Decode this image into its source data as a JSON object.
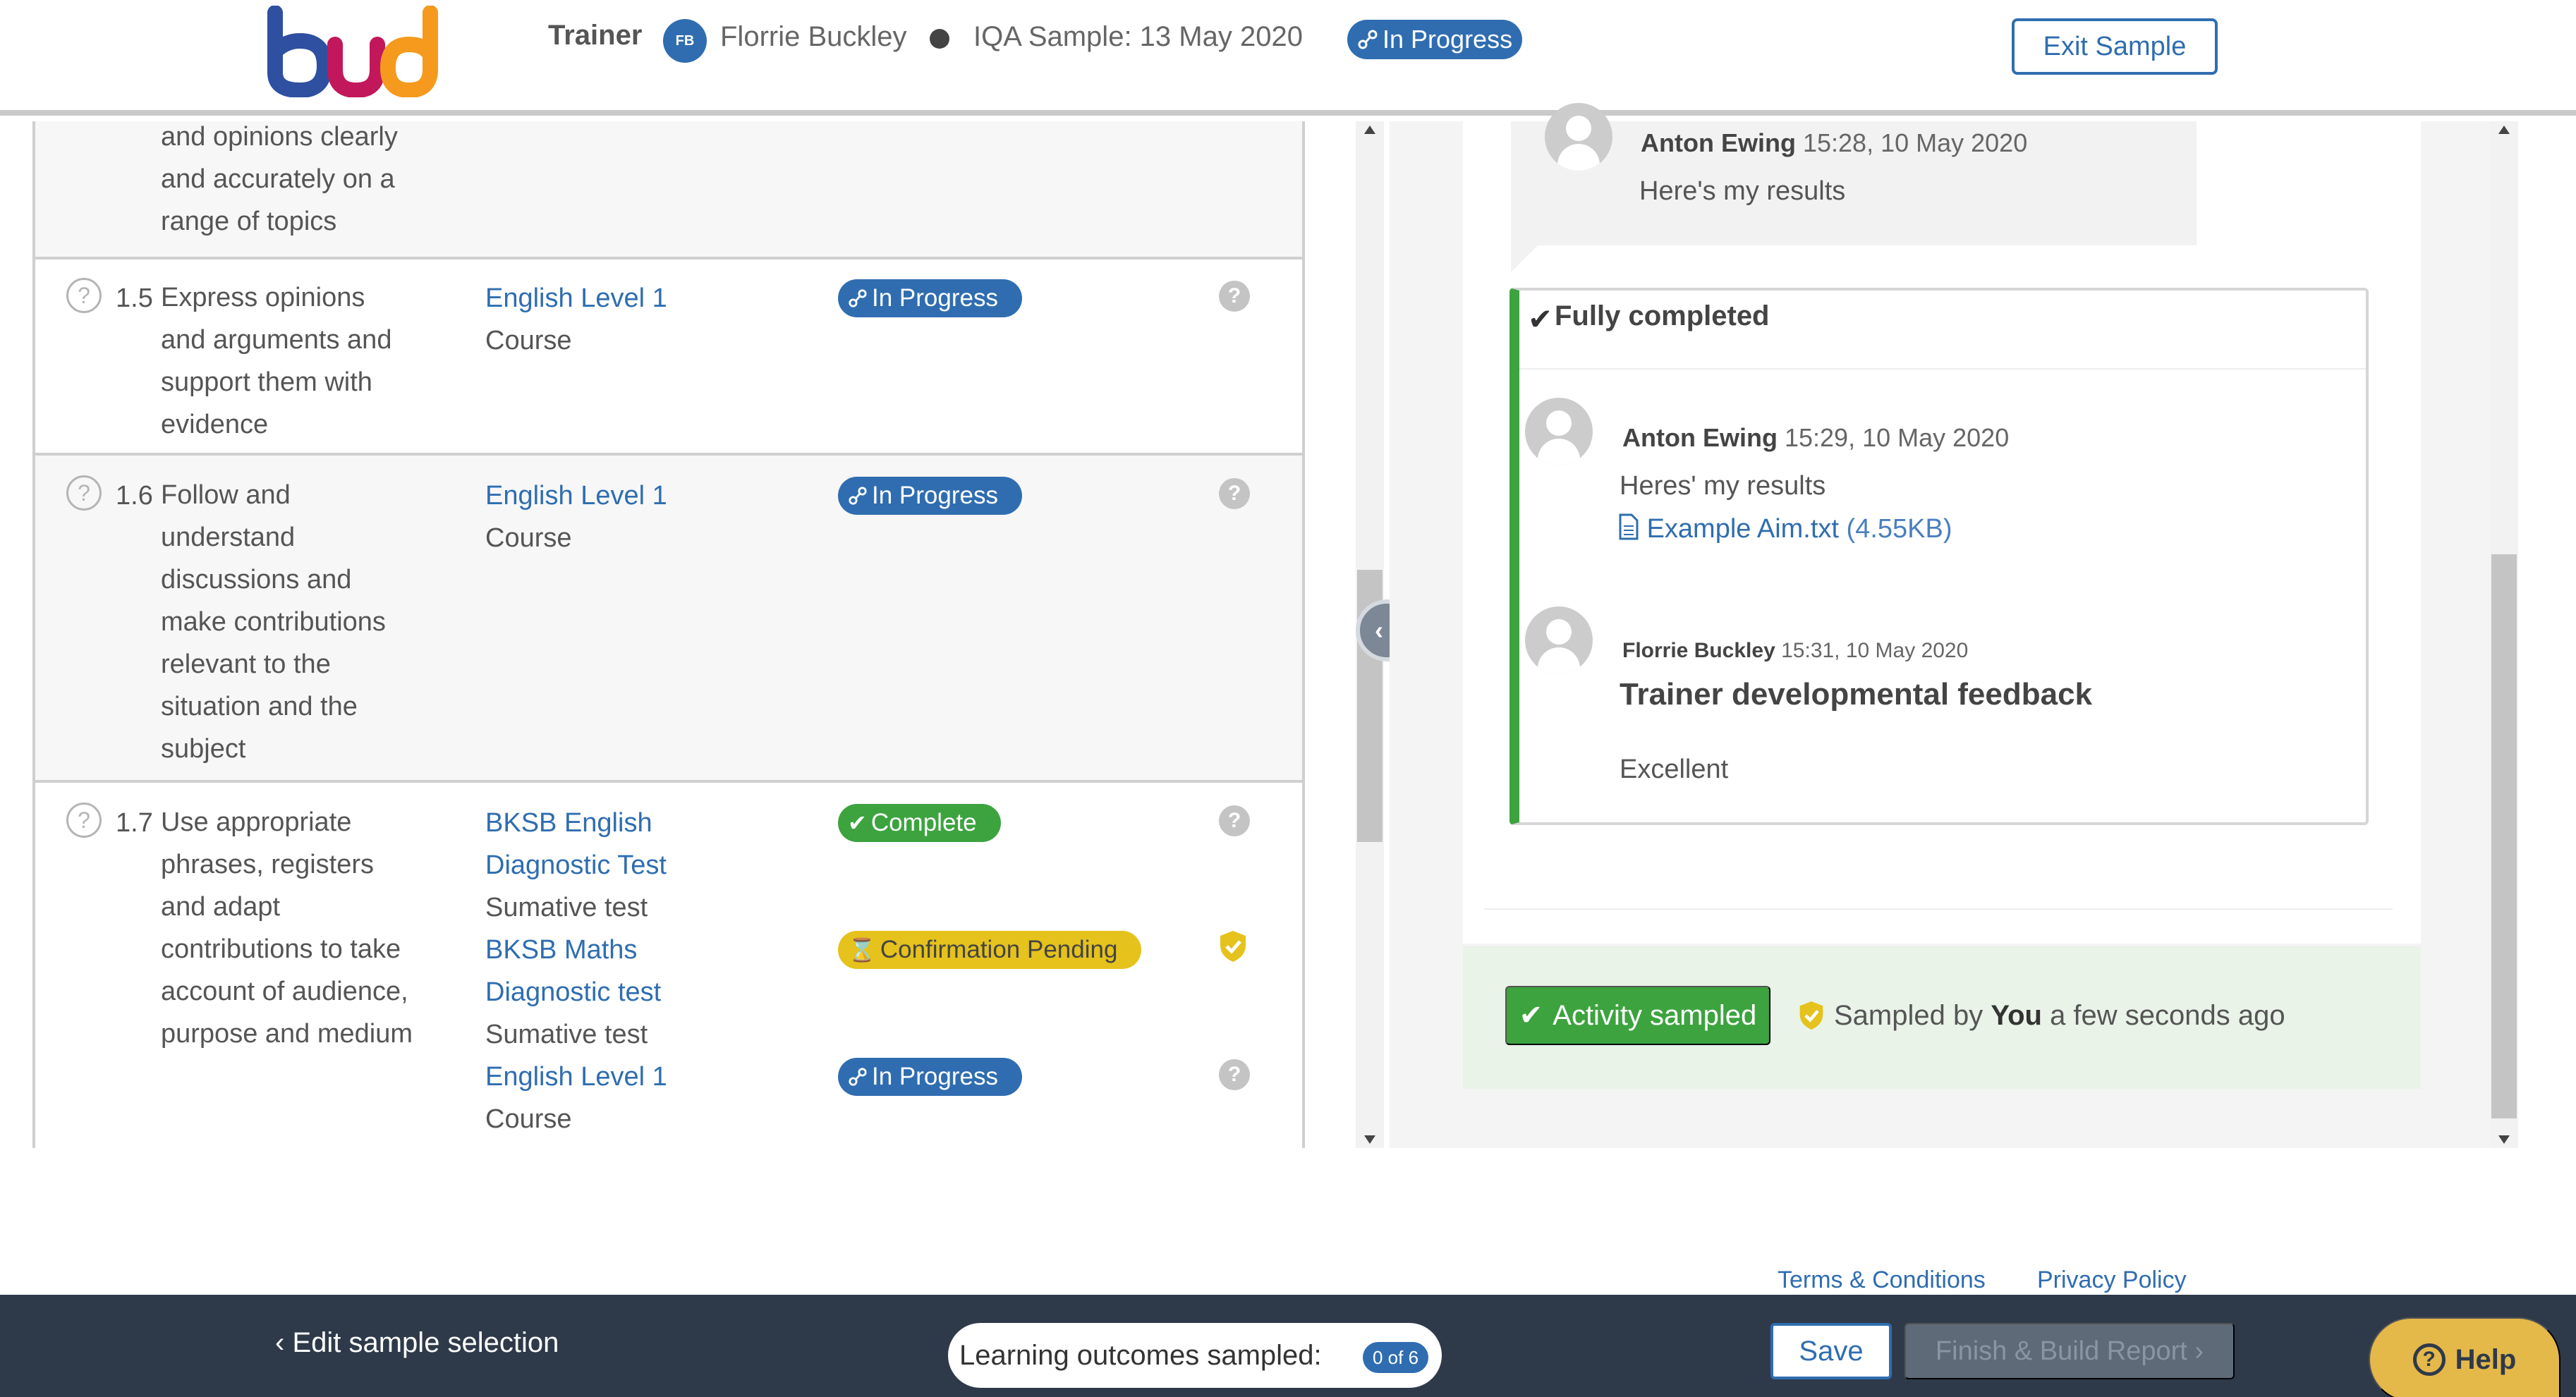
{
  "header": {
    "role": "Trainer",
    "avatar_initials": "FB",
    "user_name": "Florrie Buckley",
    "sample_label": "IQA Sample: 13 May 2020",
    "status": "In Progress",
    "exit_label": "Exit Sample"
  },
  "outcomes": {
    "partial_desc": [
      "and opinions clearly",
      "and accurately on a",
      "range of topics"
    ],
    "rows": [
      {
        "num": "1.5",
        "desc": [
          "Express opinions",
          "and arguments and",
          "support them with",
          "evidence"
        ],
        "activities": [
          {
            "title": "English Level 1",
            "type": "Course",
            "status": "In Progress"
          }
        ]
      },
      {
        "num": "1.6",
        "desc": [
          "Follow and",
          "understand",
          "discussions and",
          "make contributions",
          "relevant to the",
          "situation and the",
          "subject"
        ],
        "activities": [
          {
            "title": "English Level 1",
            "type": "Course",
            "status": "In Progress"
          }
        ]
      },
      {
        "num": "1.7",
        "desc": [
          "Use appropriate",
          "phrases, registers",
          "and adapt",
          "contributions to take",
          "account of audience,",
          "purpose and medium"
        ],
        "activities": [
          {
            "title_lines": [
              "BKSB English",
              "Diagnostic Test"
            ],
            "type": "Sumative test",
            "status": "Complete"
          },
          {
            "title_lines": [
              "BKSB Maths",
              "Diagnostic test"
            ],
            "type": "Sumative test",
            "status": "Confirmation Pending"
          },
          {
            "title": "English Level 1",
            "type": "Course",
            "status": "In Progress"
          }
        ]
      }
    ]
  },
  "activity_panel": {
    "first_message": {
      "author": "Anton Ewing",
      "time": "15:28, 10 May 2020",
      "text": "Here's my results"
    },
    "completed_title": "Fully completed",
    "second_message": {
      "author": "Anton Ewing",
      "time": "15:29, 10 May 2020",
      "text": "Heres' my results",
      "file_name": "Example Aim.txt",
      "file_size": "(4.55KB)"
    },
    "feedback": {
      "author": "Florrie Buckley",
      "time": "15:31, 10 May 2020",
      "title": "Trainer developmental feedback",
      "text": "Excellent"
    },
    "sampled_button": "Activity sampled",
    "sampled_by_prefix": "Sampled by",
    "sampled_by_user": "You",
    "sampled_by_suffix": "a few seconds ago"
  },
  "footer": {
    "terms": "Terms & Conditions",
    "privacy": "Privacy Policy"
  },
  "bottom_bar": {
    "edit_selection": "Edit sample selection",
    "outcomes_label": "Learning outcomes sampled:",
    "outcomes_count": "0 of 6",
    "save": "Save",
    "finish": "Finish & Build Report",
    "help": "Help"
  },
  "colors": {
    "primary": "#2f6db0",
    "success": "#3da33f",
    "pending": "#e5c21c",
    "bottom_bar": "#2e3a4a",
    "help": "#e5b84a"
  }
}
